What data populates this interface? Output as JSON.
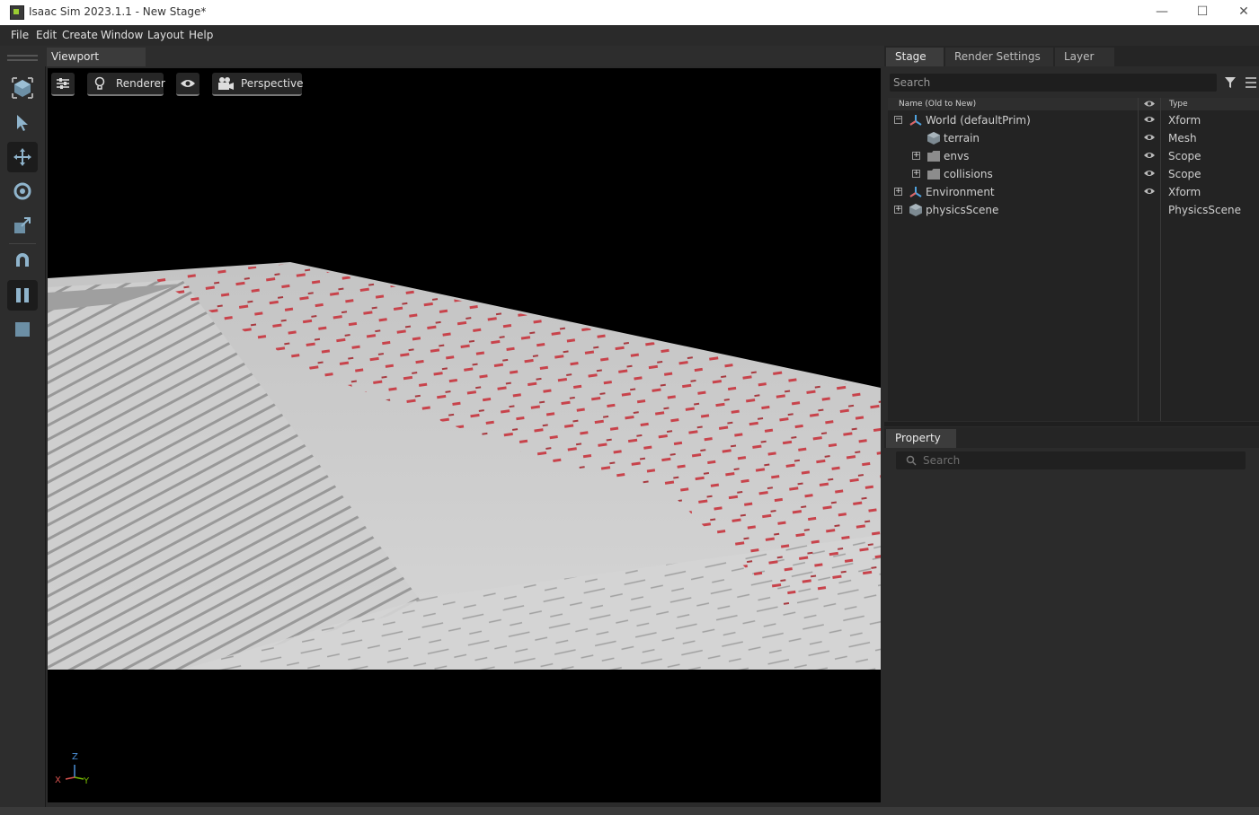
{
  "window": {
    "title": "Isaac Sim 2023.1.1 - New Stage*",
    "minimize": "—",
    "maximize": "☐",
    "close": "✕"
  },
  "menu": [
    "File",
    "Edit",
    "Create",
    "Window",
    "Layout",
    "Help"
  ],
  "viewport": {
    "tab": "Viewport",
    "buttons": {
      "renderer": "Renderer",
      "camera": "Perspective"
    },
    "axis": {
      "z": "Z",
      "x": "X",
      "y": "Y"
    }
  },
  "stage": {
    "tabs": [
      "Stage",
      "Render Settings",
      "Layer"
    ],
    "search_placeholder": "Search",
    "columns": {
      "name": "Name (Old to New)",
      "type": "Type"
    },
    "rows": [
      {
        "name": "World (defaultPrim)",
        "type": "Xform",
        "expander": "−",
        "icon": "xform-icon",
        "visible": true
      },
      {
        "name": "terrain",
        "type": "Mesh",
        "expander": "",
        "icon": "mesh-icon",
        "visible": true
      },
      {
        "name": "envs",
        "type": "Scope",
        "expander": "+",
        "icon": "folder-icon",
        "visible": true
      },
      {
        "name": "collisions",
        "type": "Scope",
        "expander": "+",
        "icon": "folder-icon",
        "visible": true
      },
      {
        "name": "Environment",
        "type": "Xform",
        "expander": "+",
        "icon": "xform-icon",
        "visible": true
      },
      {
        "name": "physicsScene",
        "type": "PhysicsScene",
        "expander": "+",
        "icon": "mesh-icon",
        "visible": false
      }
    ]
  },
  "property": {
    "tab": "Property",
    "search_placeholder": "Search"
  },
  "colors": {
    "accent": "#76b900",
    "robot": "#c8434b"
  }
}
